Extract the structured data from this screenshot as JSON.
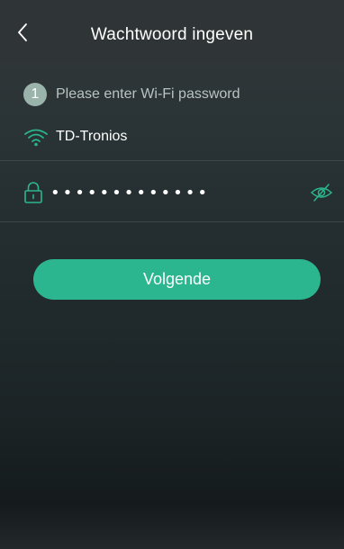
{
  "header": {
    "title": "Wachtwoord ingeven",
    "back_icon": "chevron-left-icon"
  },
  "step": {
    "number": "1",
    "text": "Please enter Wi-Fi password"
  },
  "network": {
    "icon": "wifi-icon",
    "ssid": "TD-Tronios"
  },
  "password": {
    "value": "•••••••••••••",
    "lock_icon": "lock-icon",
    "visibility_icon": "eye-off-icon"
  },
  "actions": {
    "next_label": "Volgende"
  },
  "colors": {
    "accent": "#2bb68f",
    "header_bg": "#2f3436",
    "step_badge": "#9ab3ab"
  }
}
